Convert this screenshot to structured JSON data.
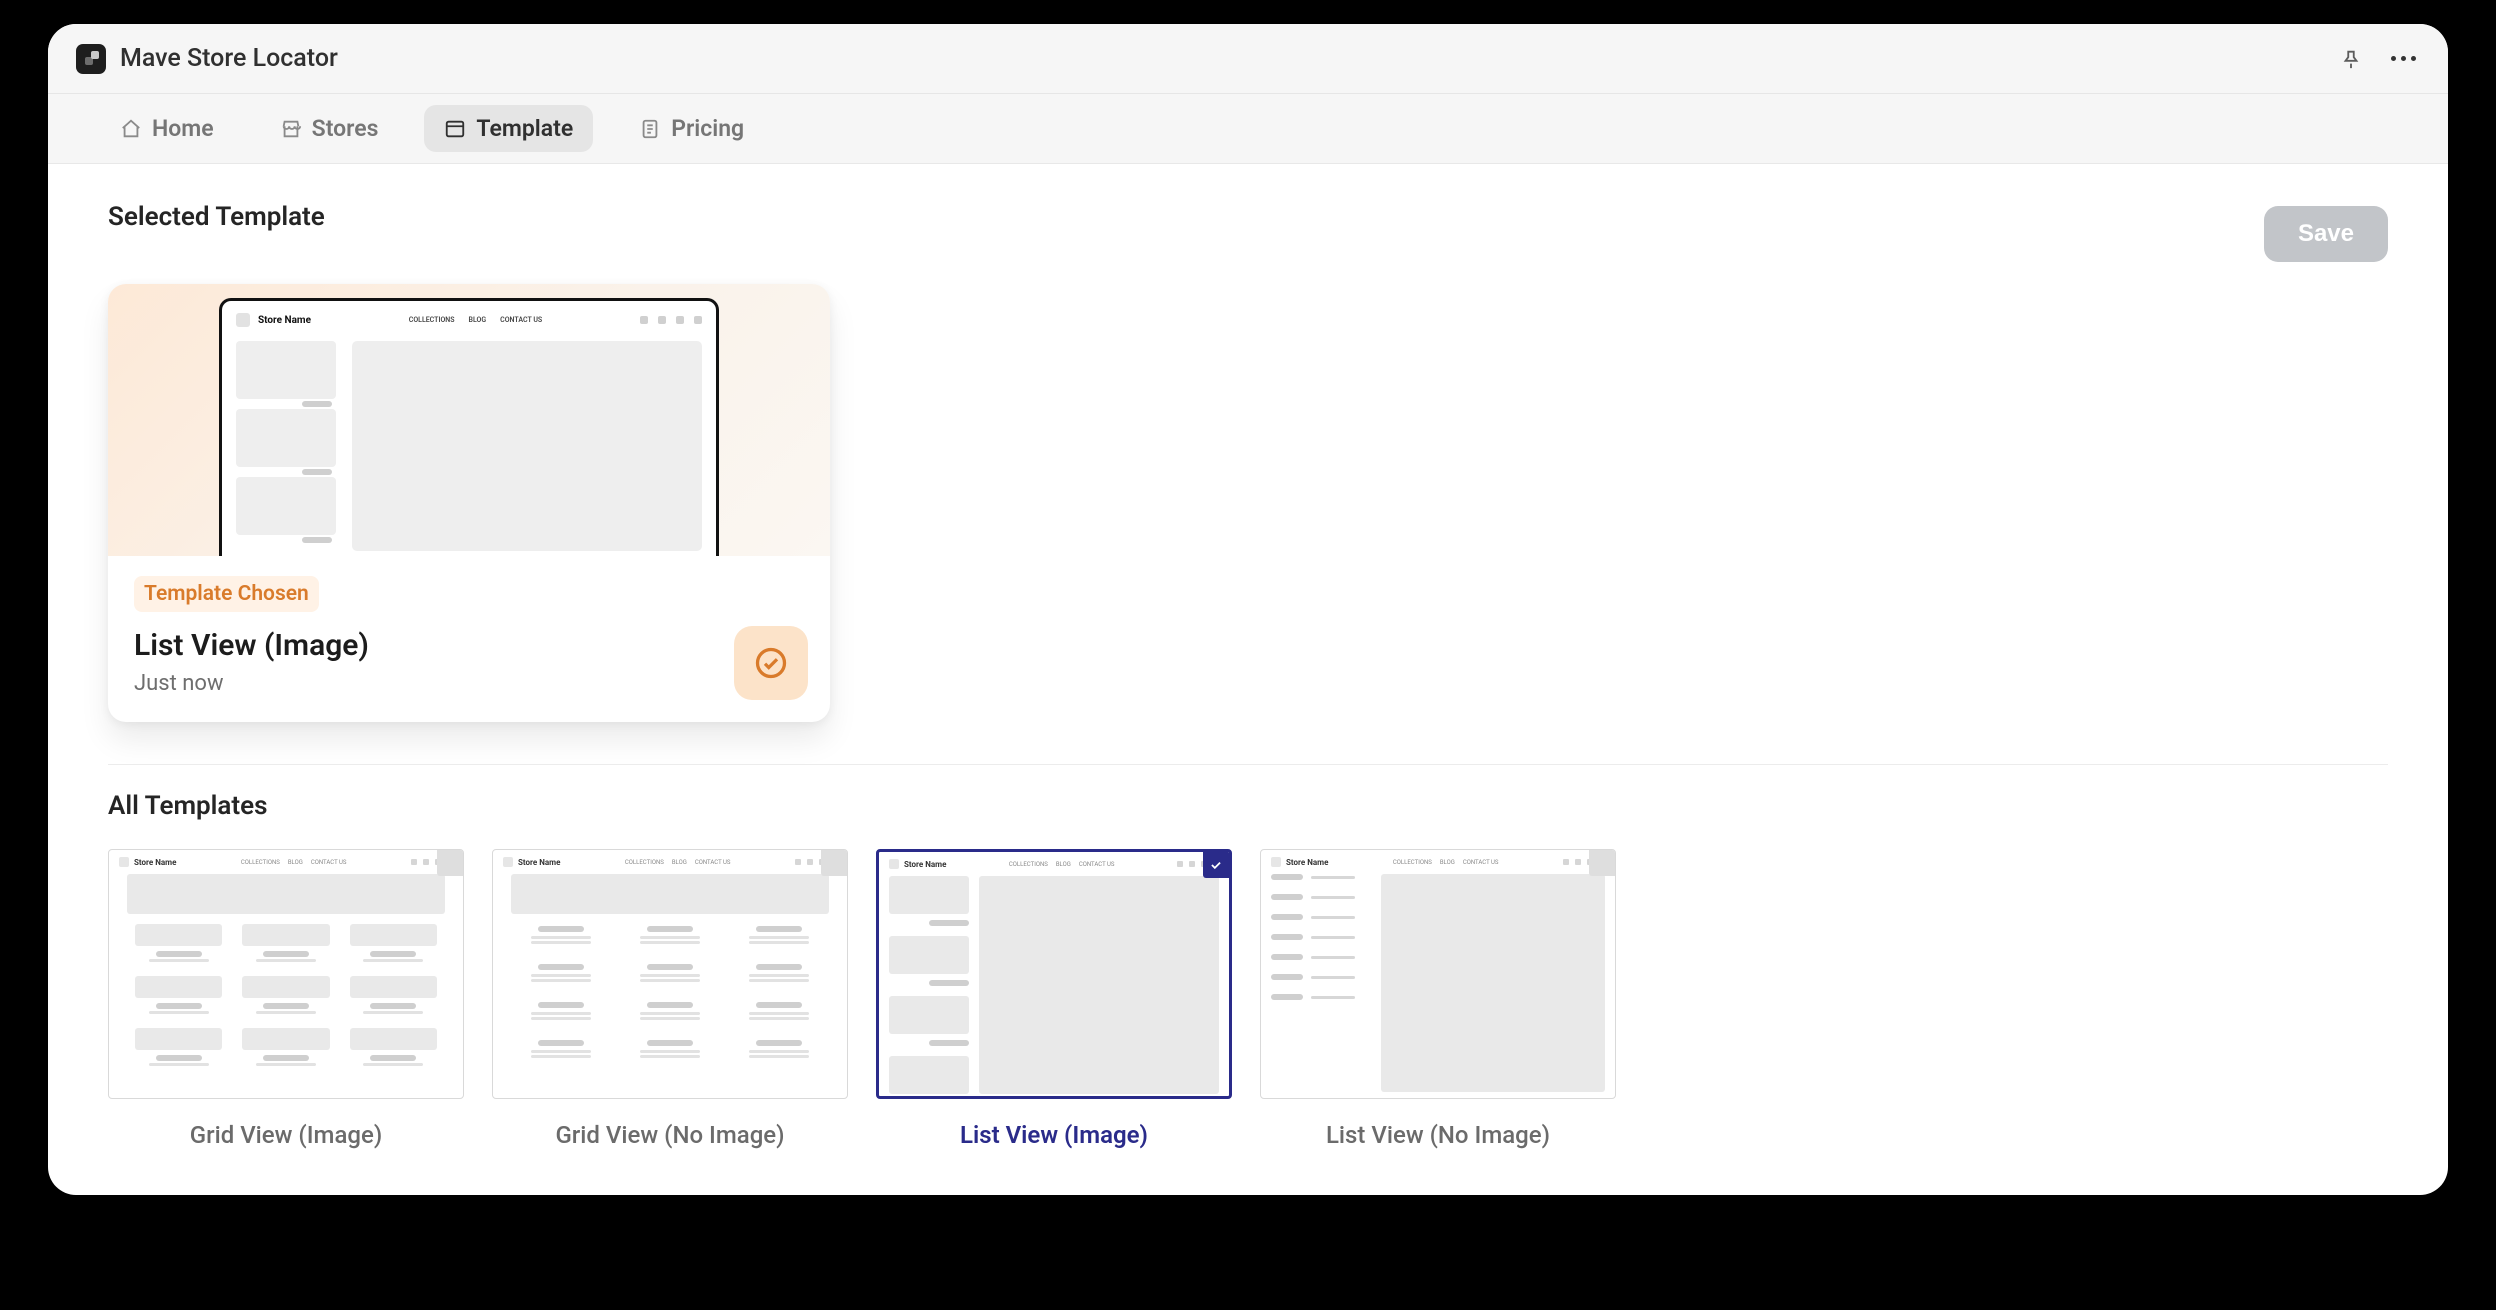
{
  "app": {
    "title": "Mave Store Locator"
  },
  "tabs": {
    "items": [
      {
        "label": "Home",
        "active": false
      },
      {
        "label": "Stores",
        "active": false
      },
      {
        "label": "Template",
        "active": true
      },
      {
        "label": "Pricing",
        "active": false
      }
    ]
  },
  "actions": {
    "save_label": "Save"
  },
  "selected": {
    "section_title": "Selected Template",
    "badge": "Template Chosen",
    "name": "List View (Image)",
    "time": "Just now"
  },
  "mockup": {
    "store_label": "Store Name",
    "nav": [
      "COLLECTIONS",
      "BLOG",
      "CONTACT US"
    ]
  },
  "all": {
    "section_title": "All Templates",
    "items": [
      {
        "label": "Grid View (Image)",
        "selected": false
      },
      {
        "label": "Grid View (No Image)",
        "selected": false
      },
      {
        "label": "List View (Image)",
        "selected": true
      },
      {
        "label": "List View (No Image)",
        "selected": false
      }
    ]
  }
}
